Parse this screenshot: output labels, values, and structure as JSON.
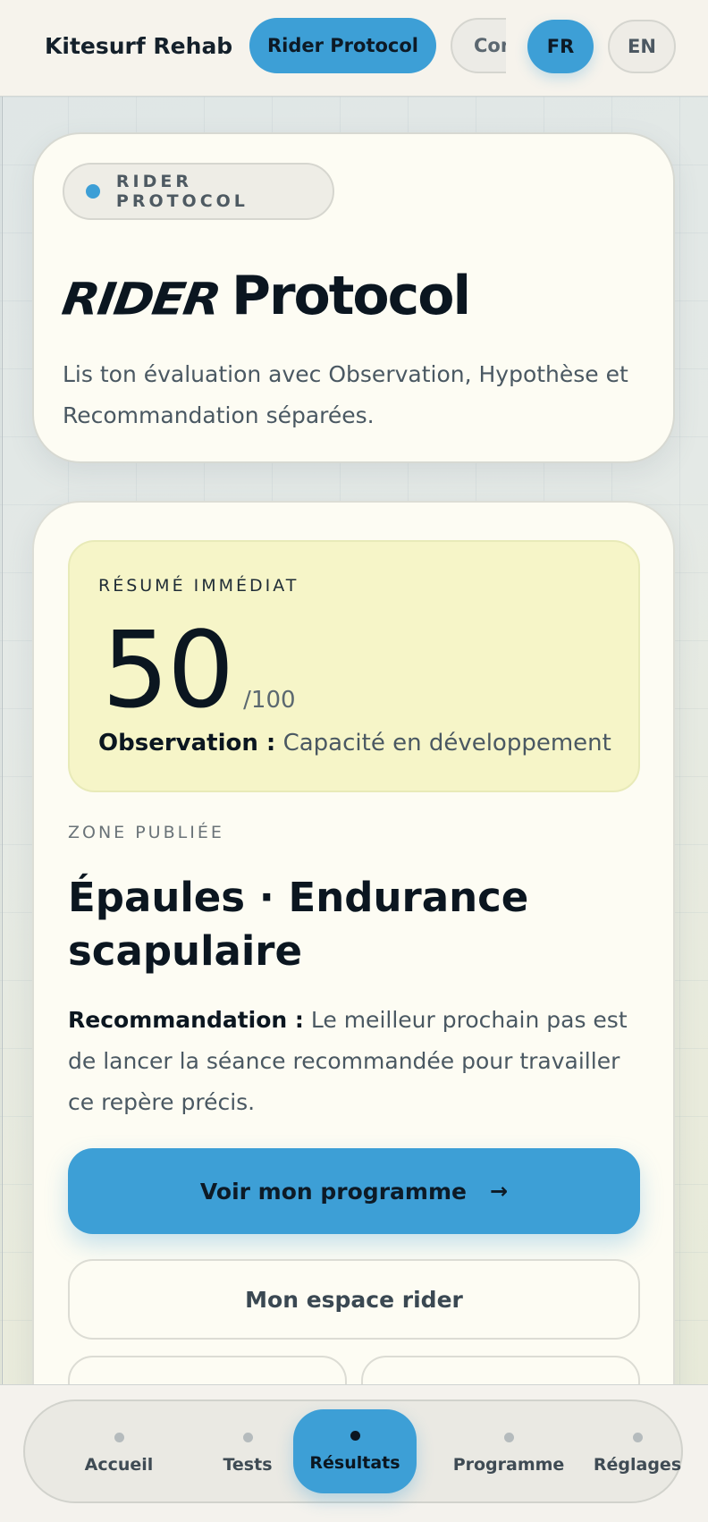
{
  "header": {
    "brand": "Kitesurf Rehab",
    "nav": [
      {
        "label": "Rider Protocol",
        "active": true
      },
      {
        "label": "Compte",
        "active": false
      }
    ],
    "languages": [
      {
        "label": "FR",
        "active": true
      },
      {
        "label": "EN",
        "active": false
      }
    ]
  },
  "hero": {
    "eyebrow": "RIDER PROTOCOL",
    "title_script": "RIDER",
    "title_plain": "Protocol",
    "description": "Lis ton évaluation avec Observation, Hypothèse et Recommandation séparées."
  },
  "results": {
    "summary_label": "RÉSUMÉ IMMÉDIAT",
    "score": "50",
    "score_max": "/100",
    "observation_label": "Observation :",
    "observation_text": "Capacité en développement",
    "zone_label": "ZONE PUBLIÉE",
    "zone_title": "Épaules · Endurance scapulaire",
    "recommendation_label": "Recommandation :",
    "recommendation_text": "Le meilleur prochain pas est de lancer la séance recommandée pour travailler ce repère précis.",
    "cta_label": "Voir mon programme",
    "cta_arrow": "→",
    "secondary_label": "Mon espace rider"
  },
  "tabbar": [
    {
      "label": "Accueil",
      "active": false
    },
    {
      "label": "Tests",
      "active": false
    },
    {
      "label": "Résultats",
      "active": true
    },
    {
      "label": "Programme",
      "active": false
    },
    {
      "label": "Réglages",
      "active": false
    }
  ],
  "colors": {
    "accent": "#3d9fd6",
    "summary_bg": "#f6f5c8",
    "card_bg": "#fdfcf3",
    "text_dark": "#0b1620"
  }
}
